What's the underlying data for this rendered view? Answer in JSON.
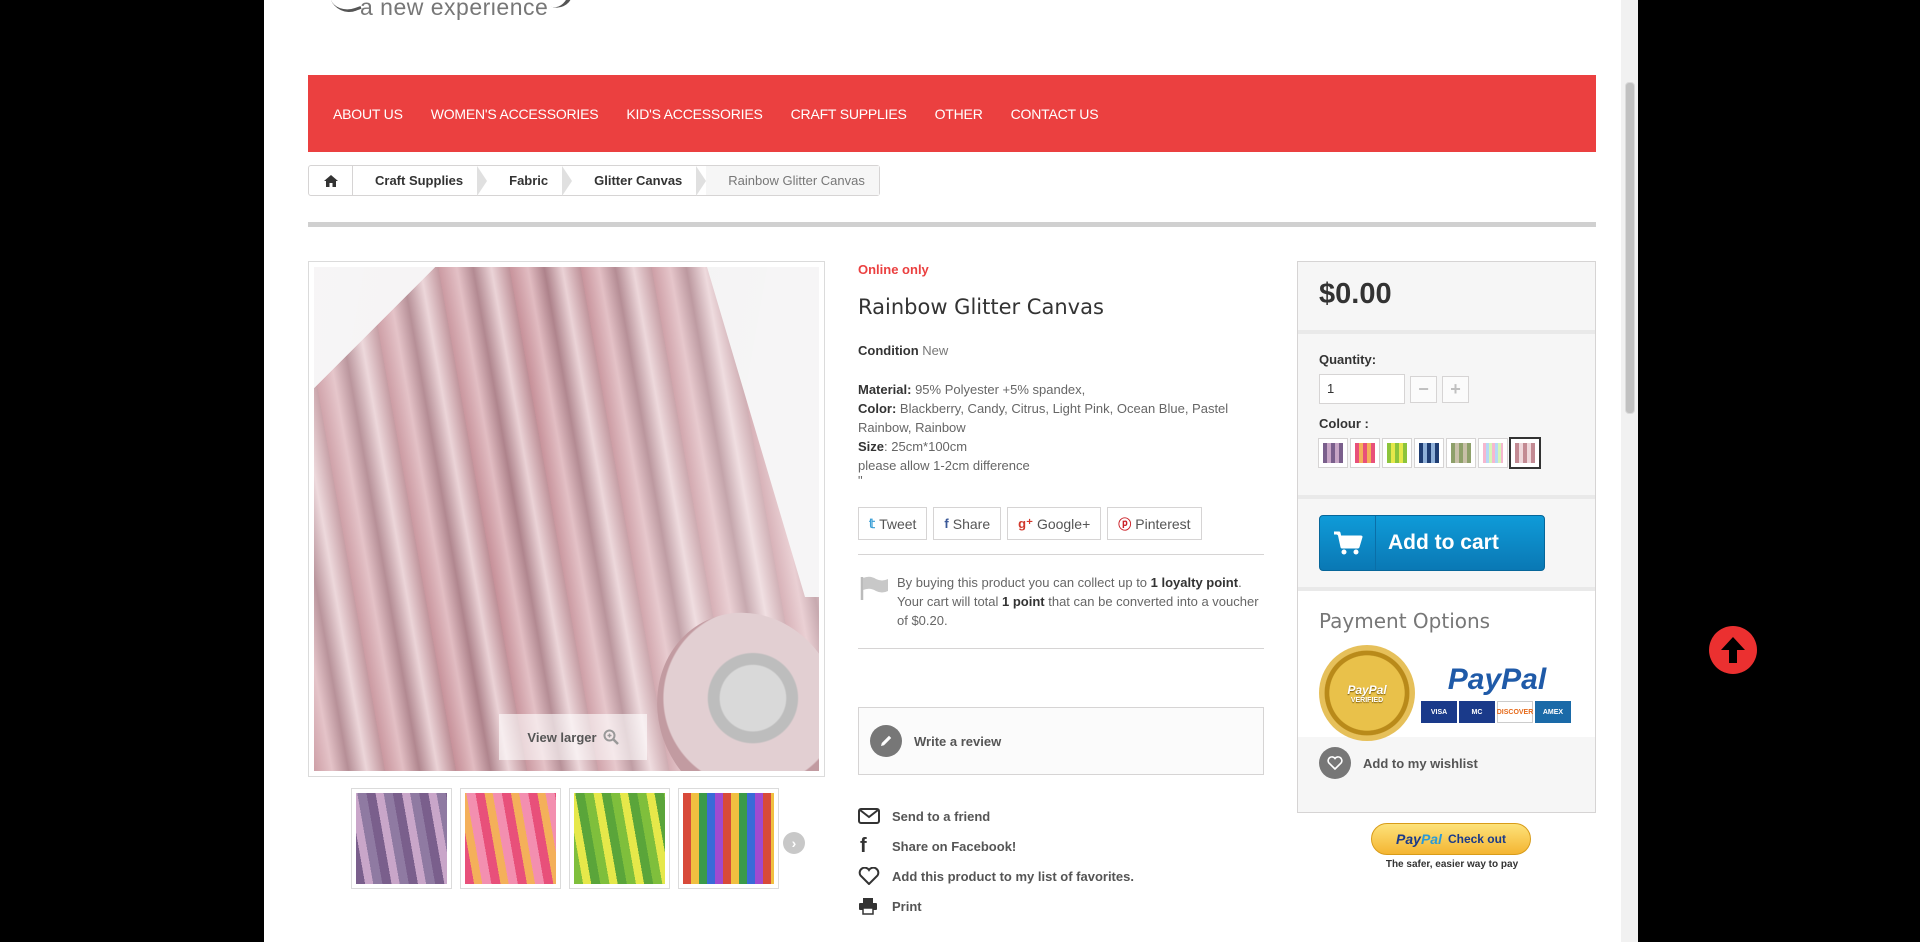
{
  "brand": {
    "tagline": "a new experience"
  },
  "nav": {
    "items": [
      "ABOUT US",
      "WOMEN'S ACCESSORIES",
      "KID'S ACCESSORIES",
      "CRAFT SUPPLIES",
      "OTHER",
      "CONTACT US"
    ]
  },
  "breadcrumb": {
    "home_icon": "home-icon",
    "items": [
      "Craft Supplies",
      "Fabric",
      "Glitter Canvas"
    ],
    "current": "Rainbow Glitter Canvas"
  },
  "gallery": {
    "view_larger": "View larger",
    "thumbnails": [
      "thumb-1",
      "thumb-2",
      "thumb-3",
      "thumb-4"
    ]
  },
  "product": {
    "online_only": "Online only",
    "title": "Rainbow Glitter Canvas",
    "condition_label": "Condition",
    "condition_value": "New",
    "material_label": "Material:",
    "material_value": " 95% Polyester +5% spandex,",
    "color_label": "Color:",
    "color_value": " Blackberry, Candy, Citrus, Light Pink, Ocean Blue, Pastel Rainbow, Rainbow",
    "size_label": "Size",
    "size_value": ": 25cm*100cm",
    "note": "please allow 1-2cm difference",
    "quote": "\""
  },
  "social": {
    "tweet": "Tweet",
    "share": "Share",
    "google": "Google+",
    "pinterest": "Pinterest"
  },
  "loyalty": {
    "text1": "By buying this product you can collect up to ",
    "points": "1 loyalty point",
    "text2": ". Your cart will total ",
    "total": "1 point",
    "text3": " that can be converted into a voucher of $0.20."
  },
  "review": {
    "label": "Write a review"
  },
  "links": {
    "send": "Send to a friend",
    "facebook": "Share on Facebook!",
    "favorites": "Add this product to my list of favorites.",
    "print": "Print"
  },
  "buybox": {
    "price": "$0.00",
    "quantity_label": "Quantity:",
    "quantity_value": "1",
    "colour_label": "Colour :",
    "selected_colour_index": 6,
    "add_to_cart": "Add to cart",
    "payment_title": "Payment Options",
    "seal_top": "PayPal",
    "seal_bottom": "VERIFIED",
    "paypal_word": "PayPal",
    "cards": [
      "VISA",
      "MC",
      "DISCOVER",
      "AMEX"
    ],
    "wishlist": "Add to my wishlist"
  },
  "paypal_checkout": {
    "pay": "Pay",
    "pal": "Pal",
    "checkout": "Check out",
    "tagline": "The safer, easier way to pay"
  },
  "colors": {
    "accent": "#eb4040",
    "cart": "#0f9bd8"
  }
}
